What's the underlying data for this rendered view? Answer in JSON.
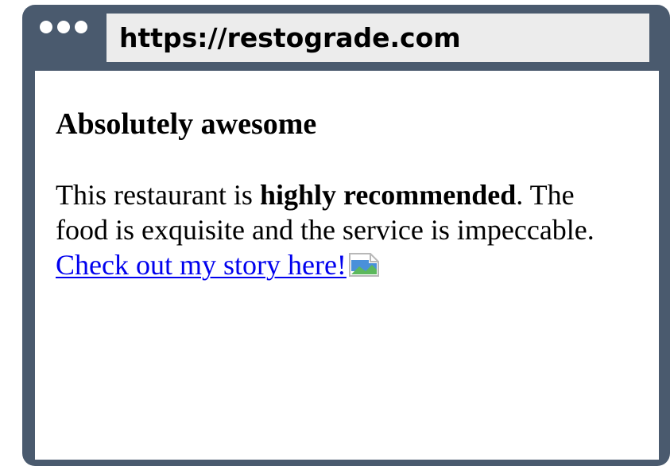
{
  "browser": {
    "url": "https://restograde.com",
    "frame_color": "#4a5a6e",
    "address_bar_color": "#ececec"
  },
  "page": {
    "heading": "Absolutely awesome",
    "review": {
      "intro": "This restaurant is ",
      "highlight": "highly recommended",
      "after_highlight": ". The food is exquisite and the service is impeccable. ",
      "link_text": "Check out my story here!",
      "link_color": "#0000ee"
    },
    "broken_image_icon": "broken-image-icon"
  }
}
